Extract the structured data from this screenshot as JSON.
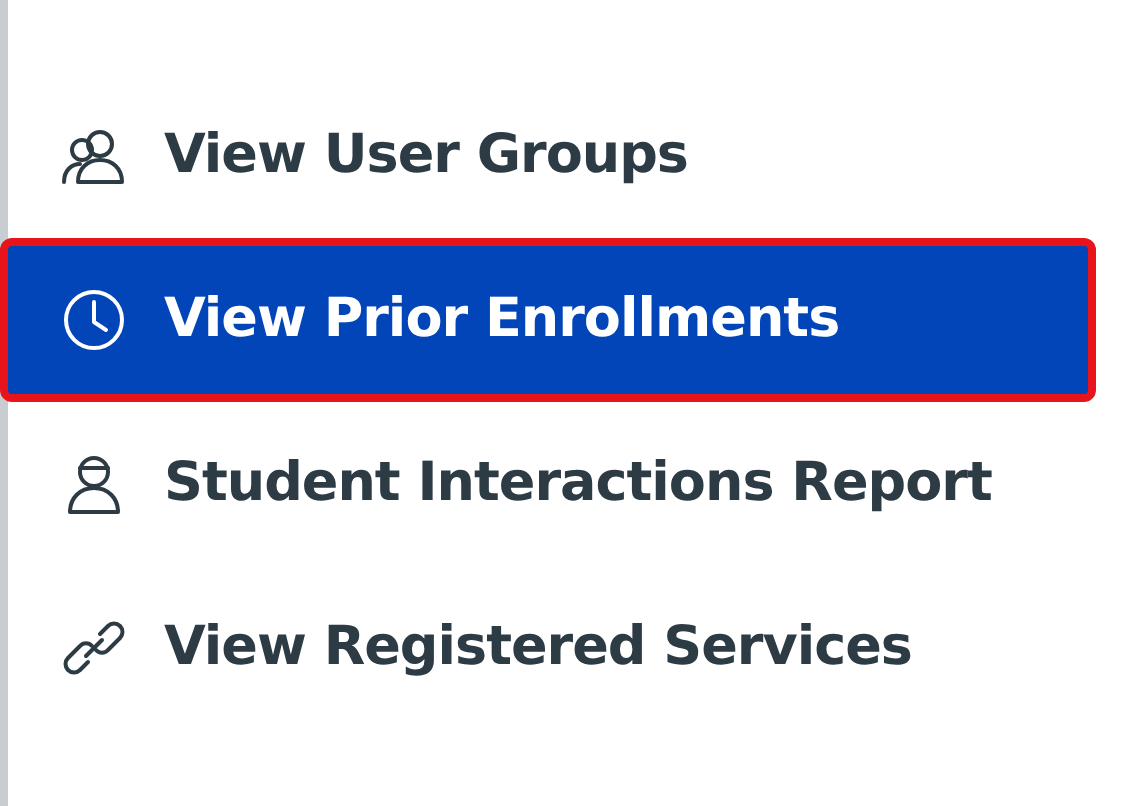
{
  "menu": [
    {
      "label": "View User Groups",
      "selected": false
    },
    {
      "label": "View Prior Enrollments",
      "selected": true
    },
    {
      "label": "Student Interactions Report",
      "selected": false
    },
    {
      "label": "View Registered Services",
      "selected": false
    }
  ]
}
